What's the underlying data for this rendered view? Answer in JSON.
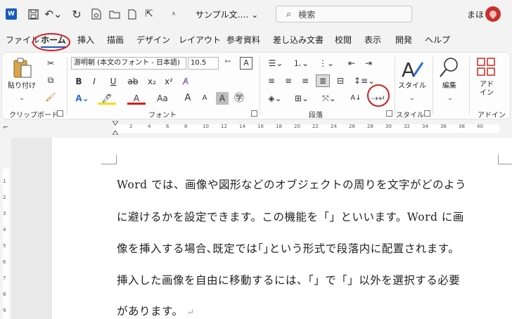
{
  "titlebar": {
    "logo": "W",
    "doc_title": "サンプル文.… ⌄",
    "search_placeholder": "検索",
    "user": "まほ",
    "icons": [
      "save-icon",
      "undo-icon",
      "redo-icon",
      "print-preview-icon",
      "open-icon",
      "new-icon",
      "select-icon",
      "customize-icon"
    ]
  },
  "tabs": [
    "ファイル",
    "ホーム",
    "挿入",
    "描画",
    "デザイン",
    "レイアウト",
    "参考資料",
    "差し込み文書",
    "校閲",
    "表示",
    "開発",
    "ヘルプ"
  ],
  "active_tab": "ホーム",
  "ribbon": {
    "clipboard": {
      "paste_label": "貼り付け",
      "group_label": "クリップボード"
    },
    "font": {
      "font_name": "游明朝 (本文のフォント - 日本語)",
      "font_size": "10.5",
      "bold": "B",
      "italic": "I",
      "underline": "U",
      "strike": "ab",
      "subscript": "x₂",
      "superscript": "x²",
      "change_case": "Aa",
      "grow": "A",
      "shrink": "A",
      "highlight_a": "A",
      "font_color_a": "A",
      "group_label": "フォント"
    },
    "paragraph": {
      "group_label": "段落"
    },
    "styles": {
      "styles_label": "スタイル",
      "group_label": "スタイル"
    },
    "editing": {
      "label": "編集"
    },
    "addin": {
      "label": "アド イン",
      "group_label": "アドイン"
    }
  },
  "ruler": [
    "2",
    "4",
    "6",
    "8",
    "10",
    "12",
    "14",
    "16",
    "18",
    "20",
    "22",
    "24",
    "26",
    "28",
    "30",
    "32",
    "34",
    "36",
    "38",
    "40"
  ],
  "vruler": [
    "1",
    "2",
    "3",
    "4",
    "5",
    "6",
    "7",
    "8",
    "9"
  ],
  "document": {
    "lines": [
      "Word では、画像や図形などのオブジェクトの周りを文字がどのよう",
      "に避けるかを設定できます。この機能を「」といいます。Word に画",
      "像を挿入する場合､既定では｢｣という形式で段落内に配置されます。",
      "挿入した画像を自由に移動するには、「」で「」以外を選択する必要",
      "があります。"
    ],
    "return_mark": "↵"
  },
  "colors": {
    "accent": "#185abd",
    "annotation_red": "#d02020"
  }
}
